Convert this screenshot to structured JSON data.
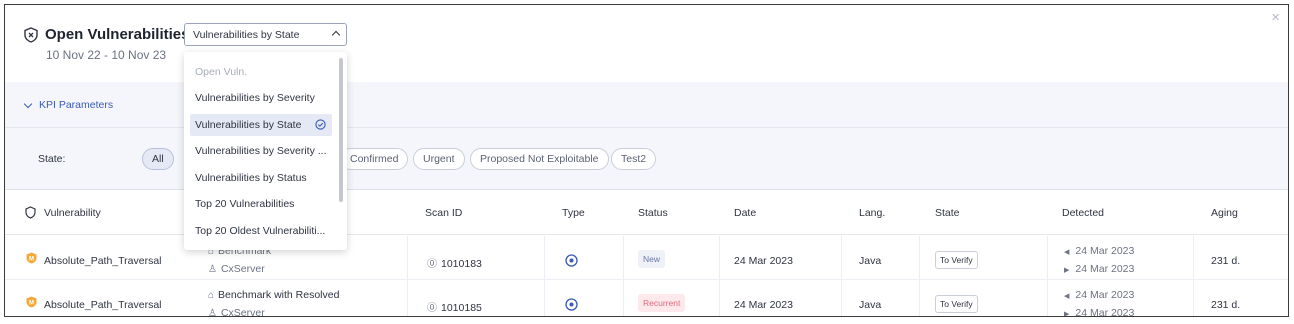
{
  "header": {
    "title": "Open Vulnerabilities",
    "date_range": "10 Nov 22 - 10 Nov 23",
    "close_glyph": "×"
  },
  "report_select": {
    "value": "Vulnerabilities by State",
    "options": [
      {
        "label": "Open Vuln.",
        "disabled": true
      },
      {
        "label": "Vulnerabilities by Severity"
      },
      {
        "label": "Vulnerabilities by State",
        "selected": true
      },
      {
        "label": "Vulnerabilities by Severity ..."
      },
      {
        "label": "Vulnerabilities by Status"
      },
      {
        "label": "Top 20 Vulnerabilities"
      },
      {
        "label": "Top 20 Oldest Vulnerabiliti..."
      }
    ]
  },
  "kpi": {
    "label": "KPI Parameters"
  },
  "state_filter": {
    "label": "State:",
    "chips": [
      {
        "label": "All",
        "active": true
      },
      {
        "label": "Confirmed"
      },
      {
        "label": "Urgent"
      },
      {
        "label": "Proposed Not Exploitable"
      },
      {
        "label": "Test2"
      }
    ]
  },
  "table": {
    "columns": [
      "Vulnerability",
      "Scan ID",
      "Type",
      "Status",
      "Date",
      "Lang.",
      "State",
      "Detected",
      "Aging"
    ],
    "rows": [
      {
        "vulnerability": "Absolute_Path_Traversal",
        "project": "Benchmark",
        "team": "CxServer",
        "scan_id": "1010183",
        "status": "New",
        "date": "24 Mar 2023",
        "lang": "Java",
        "state": "To Verify",
        "detected_first": "24 Mar 2023",
        "detected_last": "24 Mar 2023",
        "aging": "231 d."
      },
      {
        "vulnerability": "Absolute_Path_Traversal",
        "project": "Benchmark with Resolved",
        "team": "CxServer",
        "scan_id": "1010185",
        "status": "Recurrent",
        "date": "24 Mar 2023",
        "lang": "Java",
        "state": "To Verify",
        "detected_first": "24 Mar 2023",
        "detected_last": "24 Mar 2023",
        "aging": "231 d."
      }
    ]
  },
  "colors": {
    "accent": "#3b5bb5",
    "severity_medium": "#f2a93b",
    "new_badge": "#6b78a6",
    "recurrent_badge": "#e06b7e"
  }
}
